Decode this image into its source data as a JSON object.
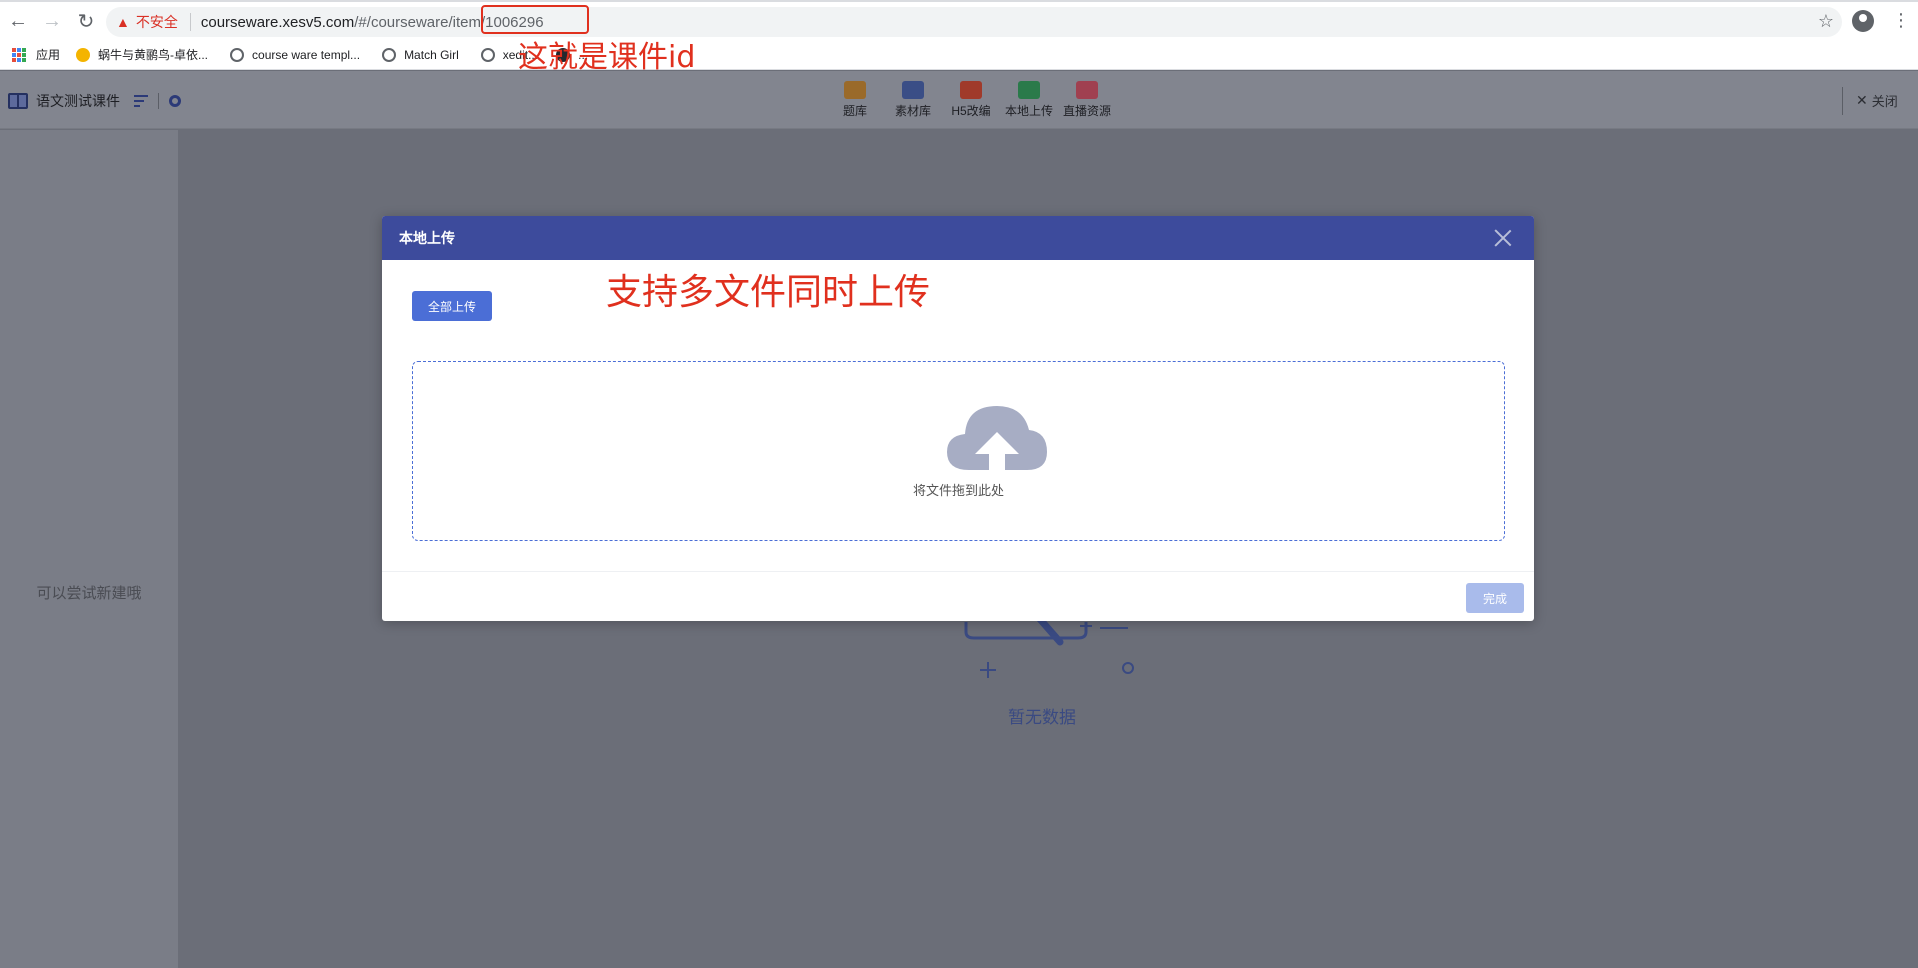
{
  "browser": {
    "not_secure_label": "不安全",
    "url_host": "courseware.xesv5.com",
    "url_path": "/#/courseware/item/",
    "url_id": "1006296"
  },
  "bookmarks": [
    {
      "label": "应用",
      "icon": "apps-icon"
    },
    {
      "label": "蜗牛与黄鹂鸟-卓依...",
      "icon": "bee-icon"
    },
    {
      "label": "course ware templ...",
      "icon": "globe-icon"
    },
    {
      "label": "Match Girl",
      "icon": "globe-icon"
    },
    {
      "label": "xedit...",
      "icon": "globe-icon"
    },
    {
      "label": "...",
      "icon": "github-icon"
    }
  ],
  "app": {
    "title": "语文测试课件",
    "close_label": "关闭",
    "toolbar": [
      {
        "label": "题库",
        "icon": "question-bank-icon"
      },
      {
        "label": "素材库",
        "icon": "media-library-icon"
      },
      {
        "label": "H5改编",
        "icon": "html5-icon"
      },
      {
        "label": "本地上传",
        "icon": "local-upload-icon"
      },
      {
        "label": "直播资源",
        "icon": "live-link-icon"
      }
    ],
    "left_hint": "可以尝试新建哦",
    "empty_text": "暂无数据"
  },
  "modal": {
    "title": "本地上传",
    "upload_all_label": "全部上传",
    "drop_text": "将文件拖到此处",
    "done_label": "完成"
  },
  "annotations": {
    "id_note": "这就是课件id",
    "multi_note": "支持多文件同时上传"
  },
  "colors": {
    "modal_header": "#3d4b9c",
    "primary": "#4b6ed6",
    "annotation": "#e0301e"
  }
}
